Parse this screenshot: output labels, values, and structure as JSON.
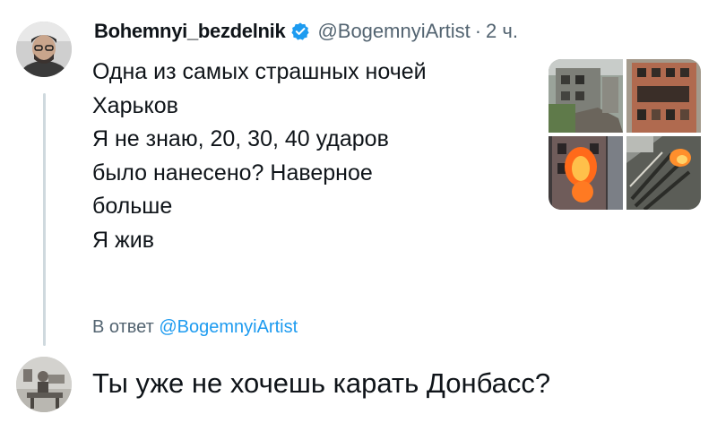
{
  "tweet": {
    "display_name": "Bohemnyi_bezdelnik",
    "handle": "@BogemnyiArtist",
    "separator": "·",
    "time": "2 ч.",
    "lines": [
      "Одна из самых страшных ночей",
      "Харьков",
      "Я не знаю, 20, 30, 40 ударов",
      "было нанесено? Наверное",
      "больше",
      "Я жив"
    ],
    "media_images": [
      "damaged-building-icon",
      "damaged-facade-icon",
      "burning-building-icon",
      "burning-balconies-icon"
    ]
  },
  "reply": {
    "reply_prefix": "В ответ",
    "reply_mention": "@BogemnyiArtist",
    "text": "Ты уже не хочешь карать Донбасс?"
  },
  "colors": {
    "text": "#0f1419",
    "secondary": "#536471",
    "link": "#1d9bf0",
    "thread_line": "#cfd9de"
  }
}
